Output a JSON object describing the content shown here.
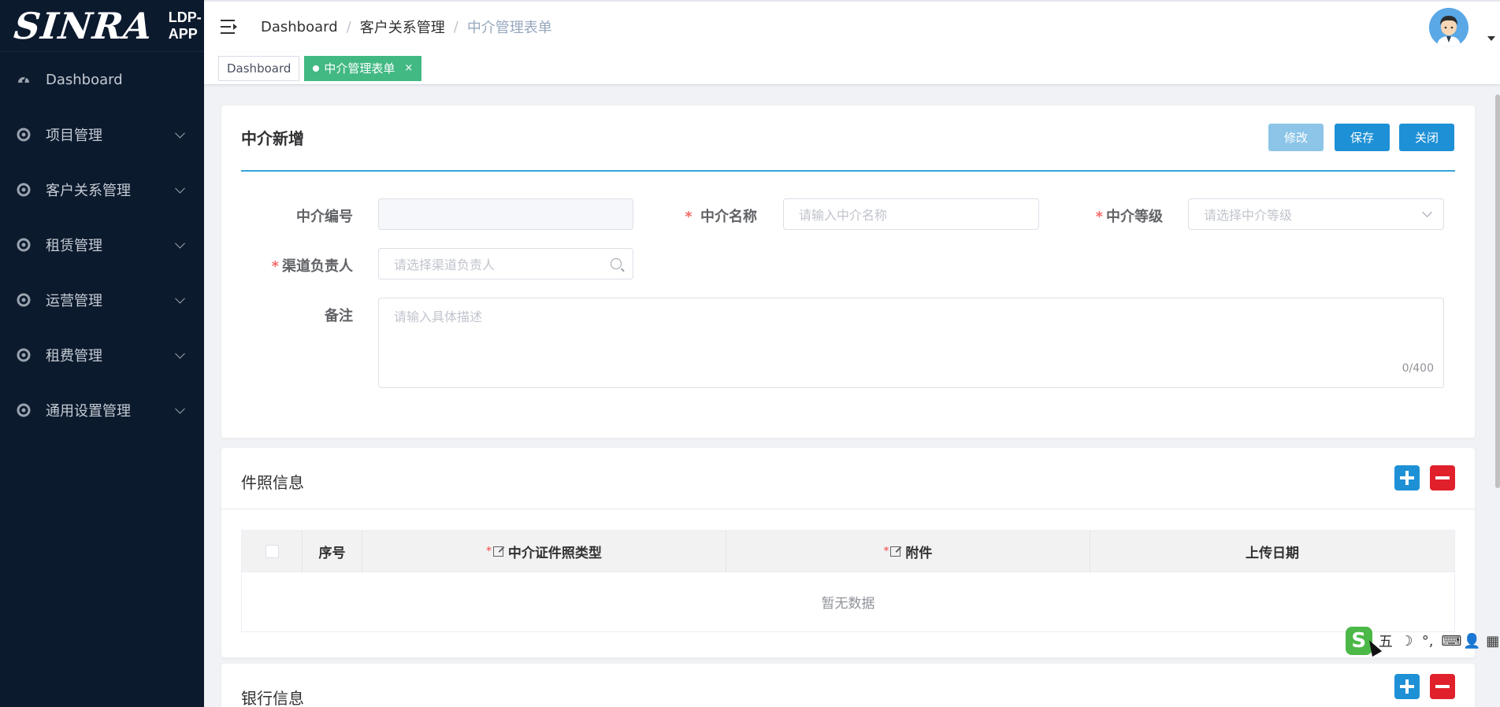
{
  "brand": {
    "logo": "SINRA",
    "app_name": "LDP-APP"
  },
  "sidebar": {
    "items": [
      {
        "label": "Dashboard",
        "icon": "dashboard-gauge-icon",
        "has_children": false
      },
      {
        "label": "项目管理",
        "icon": "circle-icon",
        "has_children": true
      },
      {
        "label": "客户关系管理",
        "icon": "circle-icon",
        "has_children": true
      },
      {
        "label": "租赁管理",
        "icon": "circle-icon",
        "has_children": true
      },
      {
        "label": "运营管理",
        "icon": "circle-icon",
        "has_children": true
      },
      {
        "label": "租费管理",
        "icon": "circle-icon",
        "has_children": true
      },
      {
        "label": "通用设置管理",
        "icon": "circle-icon",
        "has_children": true
      }
    ]
  },
  "header": {
    "breadcrumb": [
      "Dashboard",
      "客户关系管理",
      "中介管理表单"
    ]
  },
  "tags": [
    {
      "label": "Dashboard",
      "active": false
    },
    {
      "label": "中介管理表单",
      "active": true,
      "close": "×"
    }
  ],
  "form_card": {
    "title": "中介新增",
    "buttons": {
      "edit": "修改",
      "save": "保存",
      "close": "关闭"
    },
    "fields": {
      "code": {
        "label": "中介编号",
        "value": "",
        "required": false
      },
      "name": {
        "label": "中介名称",
        "placeholder": "请输入中介名称",
        "required": true
      },
      "level": {
        "label": "中介等级",
        "placeholder": "请选择中介等级",
        "required": true
      },
      "channel_owner": {
        "label": "渠道负责人",
        "placeholder": "请选择渠道负责人",
        "required": true
      },
      "remark": {
        "label": "备注",
        "placeholder": "请输入具体描述",
        "counter": "0/400"
      }
    }
  },
  "license_section": {
    "title": "件照信息",
    "columns": [
      "序号",
      "中介证件照类型",
      "附件",
      "上传日期"
    ],
    "empty_text": "暂无数据"
  },
  "bank_section": {
    "title": "银行信息"
  },
  "ime": {
    "logo": "S",
    "items": [
      "五",
      "☽",
      "°,",
      "⌨",
      "👤",
      "▦"
    ]
  },
  "colors": {
    "sidebar_bg": "#0c1a2e",
    "active_tag": "#42b983",
    "primary": "#1e90d6",
    "danger": "#e0202b"
  }
}
